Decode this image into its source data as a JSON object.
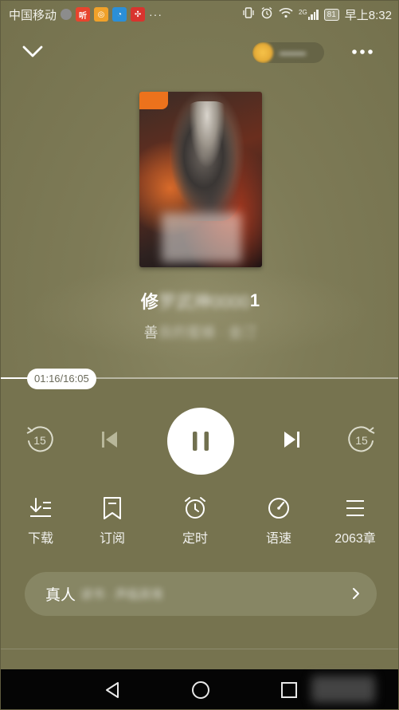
{
  "status_bar": {
    "carrier": "中国移动",
    "network_type": "2G",
    "battery": "81",
    "time": "早上8:32",
    "icons": [
      "notification-dot-icon",
      "app-ting-icon",
      "app-browser-icon",
      "app-music-icon",
      "app-game-icon",
      "more-dots-icon",
      "vibrate-icon",
      "alarm-icon",
      "wifi-icon",
      "signal-icon",
      "battery-icon"
    ]
  },
  "book": {
    "title_prefix": "修",
    "title_blurred": "罗武神0000",
    "title_suffix": "1",
    "author_prefix": "善",
    "author_blurred": "良的蜜蜂 · 金汀"
  },
  "player": {
    "current_time": "01:16",
    "total_time": "16:05",
    "time_display": "01:16/16:05",
    "progress": 0.079,
    "skip_seconds": "15"
  },
  "actions": [
    {
      "label": "下载",
      "icon": "download-icon"
    },
    {
      "label": "订阅",
      "icon": "bookmark-icon"
    },
    {
      "label": "定时",
      "icon": "alarm-timer-icon"
    },
    {
      "label": "语速",
      "icon": "speed-gauge-icon"
    },
    {
      "label": "2063章",
      "icon": "chapter-list-icon"
    }
  ],
  "banner": {
    "label": "真人",
    "blurred_text": "读书 · 声临其境"
  },
  "colors": {
    "background": "#76734f",
    "chip_text": "#6a6a5a",
    "nav_bar": "#050505"
  }
}
